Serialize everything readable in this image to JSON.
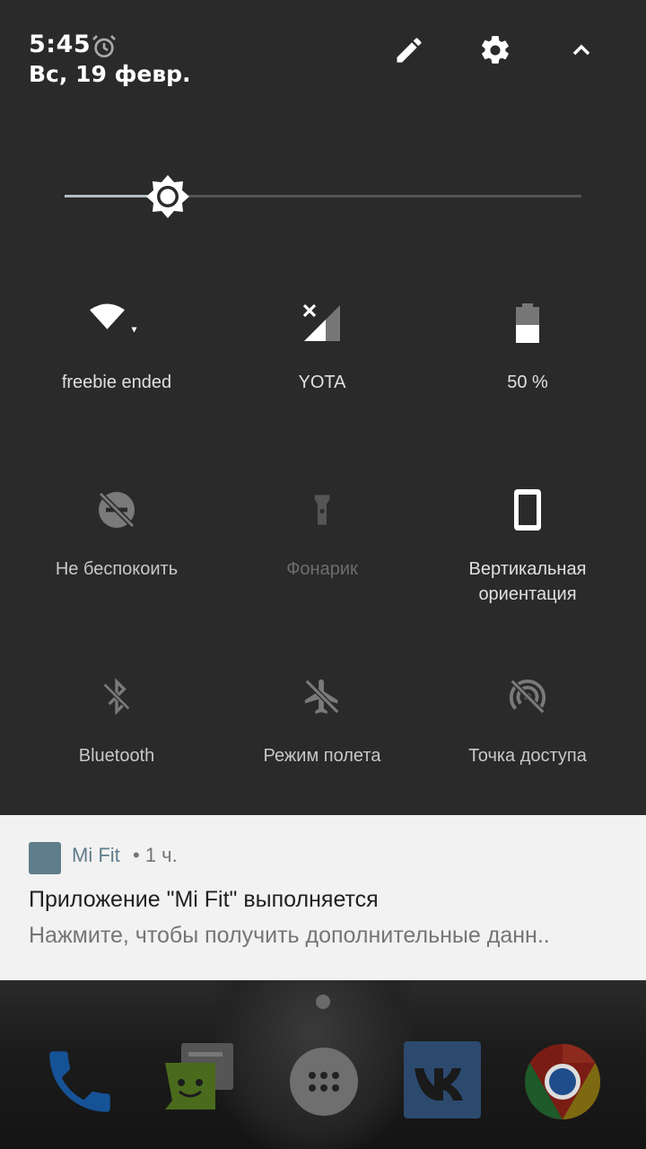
{
  "status": {
    "time": "5:45",
    "date": "Вс, 19 февр."
  },
  "header_icons": [
    "alarm-icon",
    "edit-icon",
    "settings-icon",
    "collapse-icon"
  ],
  "brightness": {
    "level": 0.2
  },
  "tiles": [
    {
      "label": "freebie ended",
      "icon": "wifi-icon",
      "state": "on"
    },
    {
      "label": "YOTA",
      "icon": "cellular-icon",
      "state": "on"
    },
    {
      "label": "50 %",
      "icon": "battery-icon",
      "state": "on"
    },
    {
      "label": "Не беспокоить",
      "icon": "do-not-disturb-icon",
      "state": "off"
    },
    {
      "label": "Фонарик",
      "icon": "flashlight-icon",
      "state": "disabled"
    },
    {
      "label": "Вертикальная\nориентация",
      "icon": "portrait-rotation-icon",
      "state": "on"
    },
    {
      "label": "Bluetooth",
      "icon": "bluetooth-icon",
      "state": "off"
    },
    {
      "label": "Режим полета",
      "icon": "airplane-icon",
      "state": "off"
    },
    {
      "label": "Точка доступа",
      "icon": "hotspot-icon",
      "state": "off"
    }
  ],
  "notification": {
    "app": "Mi Fit",
    "time": "• 1 ч.",
    "title": "Приложение \"Mi Fit\" выполняется",
    "text": "Нажмите, чтобы получить дополнительные данн.."
  },
  "dock": [
    "phone-icon",
    "messages-icon",
    "app-drawer-icon",
    "vk-icon",
    "chrome-icon"
  ],
  "colors": {
    "panel": "#2a2a2a",
    "accent": "#b0bec5",
    "notif_bg": "#f2f2f2",
    "mifit": "#607d8b"
  }
}
